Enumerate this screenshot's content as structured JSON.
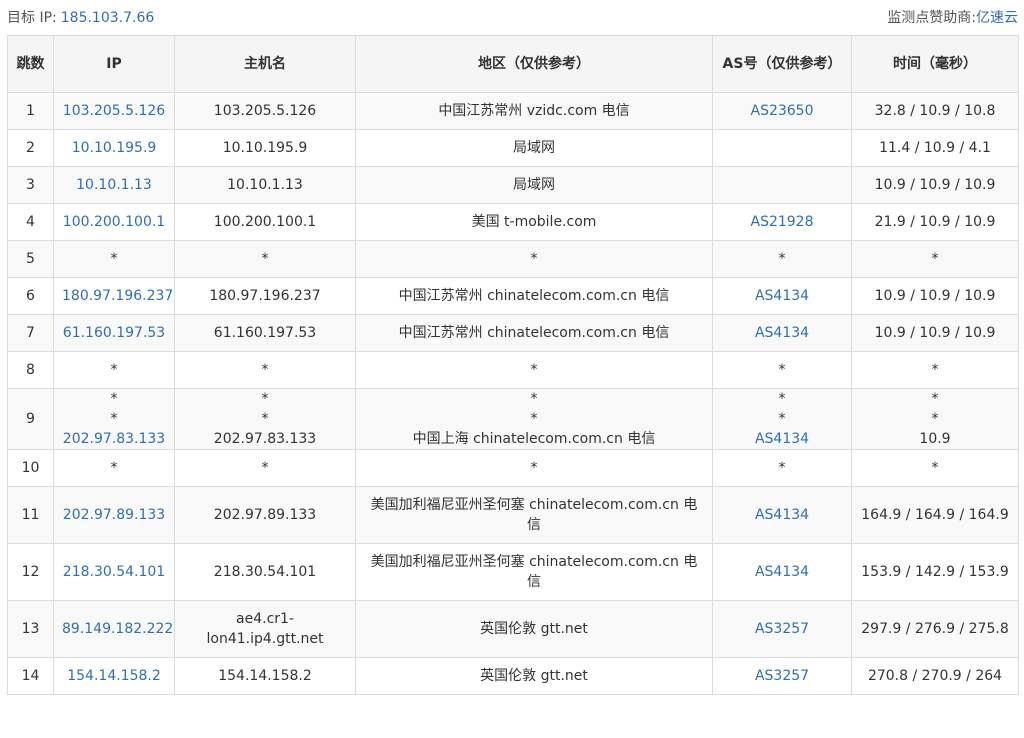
{
  "topbar": {
    "target_label": "目标 IP:",
    "target_ip": "185.103.7.66",
    "sponsor_label": "监测点赞助商:",
    "sponsor_name": "亿速云"
  },
  "headers": [
    "跳数",
    "IP",
    "主机名",
    "地区（仅供参考）",
    "AS号（仅供参考）",
    "时间（毫秒）"
  ],
  "rows": [
    {
      "hop": "1",
      "ip": "103.205.5.126",
      "host": "103.205.5.126",
      "region": "中国江苏常州 vzidc.com 电信",
      "as": "AS23650",
      "time": "32.8 / 10.9 / 10.8"
    },
    {
      "hop": "2",
      "ip": "10.10.195.9",
      "host": "10.10.195.9",
      "region": "局域网",
      "as": "",
      "time": "11.4 / 10.9 / 4.1"
    },
    {
      "hop": "3",
      "ip": "10.10.1.13",
      "host": "10.10.1.13",
      "region": "局域网",
      "as": "",
      "time": "10.9 / 10.9 / 10.9"
    },
    {
      "hop": "4",
      "ip": "100.200.100.1",
      "host": "100.200.100.1",
      "region": "美国 t-mobile.com",
      "as": "AS21928",
      "time": "21.9 / 10.9 / 10.9"
    },
    {
      "hop": "5",
      "ip": "*",
      "host": "*",
      "region": "*",
      "as": "*",
      "time": "*"
    },
    {
      "hop": "6",
      "ip": "180.97.196.237",
      "host": "180.97.196.237",
      "region": "中国江苏常州 chinatelecom.com.cn 电信",
      "as": "AS4134",
      "time": "10.9 / 10.9 / 10.9"
    },
    {
      "hop": "7",
      "ip": "61.160.197.53",
      "host": "61.160.197.53",
      "region": "中国江苏常州 chinatelecom.com.cn 电信",
      "as": "AS4134",
      "time": "10.9 / 10.9 / 10.9"
    },
    {
      "hop": "8",
      "ip": "*",
      "host": "*",
      "region": "*",
      "as": "*",
      "time": "*"
    },
    {
      "hop": "9",
      "ip_lines": [
        "*",
        "*",
        "202.97.83.133"
      ],
      "host_lines": [
        "*",
        "*",
        "202.97.83.133"
      ],
      "region_lines": [
        "*",
        "*",
        "中国上海 chinatelecom.com.cn 电信"
      ],
      "as_lines": [
        "*",
        "*",
        "AS4134"
      ],
      "time_lines": [
        "*",
        "*",
        "10.9"
      ]
    },
    {
      "hop": "10",
      "ip": "*",
      "host": "*",
      "region": "*",
      "as": "*",
      "time": "*"
    },
    {
      "hop": "11",
      "ip": "202.97.89.133",
      "host": "202.97.89.133",
      "region": "美国加利福尼亚州圣何塞 chinatelecom.com.cn 电信",
      "as": "AS4134",
      "time": "164.9 / 164.9 / 164.9"
    },
    {
      "hop": "12",
      "ip": "218.30.54.101",
      "host": "218.30.54.101",
      "region": "美国加利福尼亚州圣何塞 chinatelecom.com.cn 电信",
      "as": "AS4134",
      "time": "153.9 / 142.9 / 153.9"
    },
    {
      "hop": "13",
      "ip": "89.149.182.222",
      "host": "ae4.cr1-lon41.ip4.gtt.net",
      "region": "英国伦敦 gtt.net",
      "as": "AS3257",
      "time": "297.9 / 276.9 / 275.8"
    },
    {
      "hop": "14",
      "ip": "154.14.158.2",
      "host": "154.14.158.2",
      "region": "英国伦敦 gtt.net",
      "as": "AS3257",
      "time": "270.8 / 270.9 / 264"
    }
  ],
  "colors": {
    "link": "#2f6eb5",
    "border": "#dcdcdc",
    "header_bg": "#f5f5f5",
    "stripe_bg": "#f9f9f9"
  }
}
